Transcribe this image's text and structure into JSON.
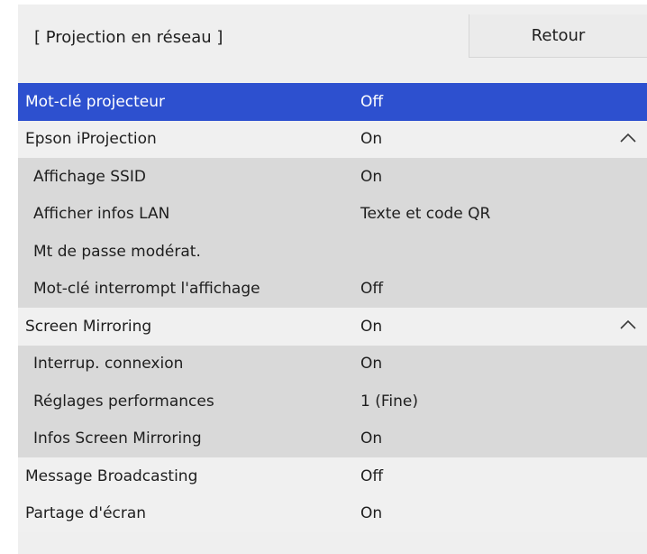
{
  "header": {
    "title": "[ Projection en réseau ]",
    "back_label": "Retour"
  },
  "menu": [
    {
      "label": "Mot-clé projecteur",
      "value": "Off",
      "level": 1,
      "selected": true,
      "expanded": null
    },
    {
      "label": "Epson iProjection",
      "value": "On",
      "level": 1,
      "selected": false,
      "expanded": true
    },
    {
      "label": "Affichage SSID",
      "value": "On",
      "level": 2,
      "selected": false,
      "expanded": null
    },
    {
      "label": "Afficher infos LAN",
      "value": "Texte et code QR",
      "level": 2,
      "selected": false,
      "expanded": null
    },
    {
      "label": "Mt de passe modérat.",
      "value": "",
      "level": 2,
      "selected": false,
      "expanded": null
    },
    {
      "label": "Mot-clé interrompt l'affichage",
      "value": "Off",
      "level": 2,
      "selected": false,
      "expanded": null
    },
    {
      "label": "Screen Mirroring",
      "value": "On",
      "level": 1,
      "selected": false,
      "expanded": true
    },
    {
      "label": "Interrup. connexion",
      "value": "On",
      "level": 2,
      "selected": false,
      "expanded": null
    },
    {
      "label": "Réglages performances",
      "value": "1 (Fine)",
      "level": 2,
      "selected": false,
      "expanded": null
    },
    {
      "label": "Infos Screen Mirroring",
      "value": "On",
      "level": 2,
      "selected": false,
      "expanded": null
    },
    {
      "label": "Message Broadcasting",
      "value": "Off",
      "level": 1,
      "selected": false,
      "expanded": null
    },
    {
      "label": "Partage d'écran",
      "value": "On",
      "level": 1,
      "selected": false,
      "expanded": null
    }
  ],
  "colors": {
    "selected_bg": "#2d50cf",
    "level1_bg": "#f0f0f0",
    "level2_bg": "#d9d9d9",
    "panel_bg": "#efefef"
  },
  "icons": {
    "expanded_chevron": "chevron-up-icon"
  }
}
